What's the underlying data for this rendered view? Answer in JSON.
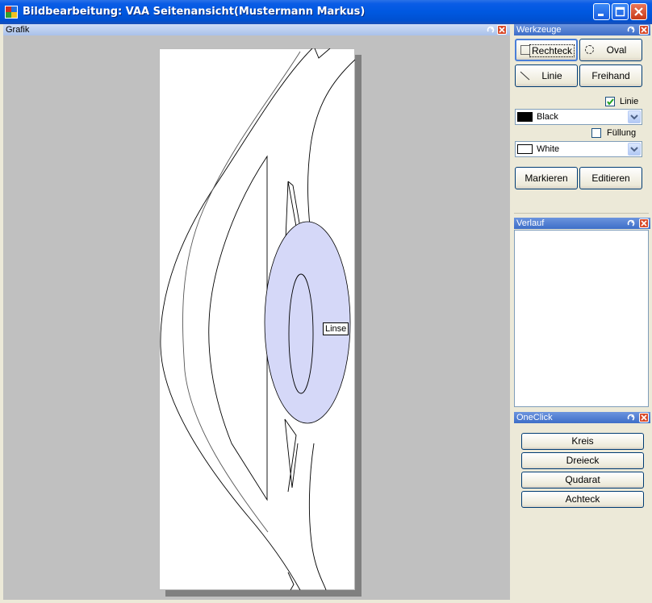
{
  "window": {
    "title": "Bildbearbeitung: VAA Seitenansicht(Mustermann Markus)"
  },
  "grafik": {
    "title": "Grafik",
    "canvas_label": "Linse"
  },
  "werkzeuge": {
    "title": "Werkzeuge",
    "buttons": {
      "rechteck": "Rechteck",
      "oval": "Oval",
      "linie": "Linie",
      "freihand": "Freihand"
    },
    "linie_checkbox": {
      "label": "Linie",
      "checked": true
    },
    "linie_color": {
      "value": "Black",
      "swatch": "#000000"
    },
    "fuellung_checkbox": {
      "label": "Füllung",
      "checked": false
    },
    "fuellung_color": {
      "value": "White",
      "swatch": "#ffffff"
    },
    "markieren": "Markieren",
    "editieren": "Editieren"
  },
  "verlauf": {
    "title": "Verlauf"
  },
  "oneclick": {
    "title": "OneClick",
    "items": [
      "Kreis",
      "Dreieck",
      "Qudarat",
      "Achteck"
    ]
  },
  "colors": {
    "lens_fill": "#d5d8f8",
    "titlebar": "#0058e0",
    "panel_header": "#3d6ec8"
  }
}
